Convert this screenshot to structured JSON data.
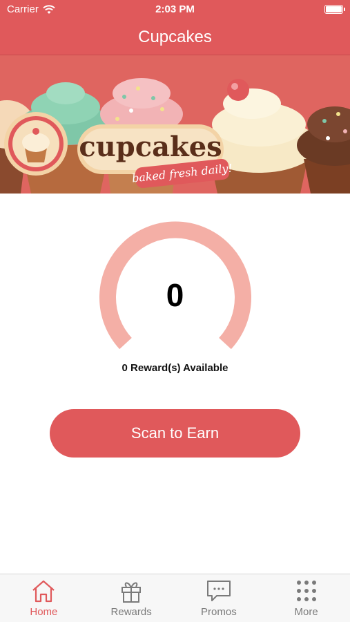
{
  "status_bar": {
    "carrier": "Carrier",
    "time": "2:03 PM"
  },
  "nav": {
    "title": "Cupcakes"
  },
  "banner": {
    "brand": "cupcakes",
    "tagline": "baked fresh daily!"
  },
  "points": {
    "value": "0",
    "available_text": "0 Reward(s) Available"
  },
  "actions": {
    "scan_label": "Scan to Earn"
  },
  "colors": {
    "accent": "#e0595b",
    "gauge": "#f4afa6",
    "tab_inactive": "#7a7a7a"
  },
  "tabs": [
    {
      "label": "Home",
      "icon": "home-icon",
      "active": true
    },
    {
      "label": "Rewards",
      "icon": "gift-icon",
      "active": false
    },
    {
      "label": "Promos",
      "icon": "chat-bubble-icon",
      "active": false
    },
    {
      "label": "More",
      "icon": "grid-dots-icon",
      "active": false
    }
  ]
}
